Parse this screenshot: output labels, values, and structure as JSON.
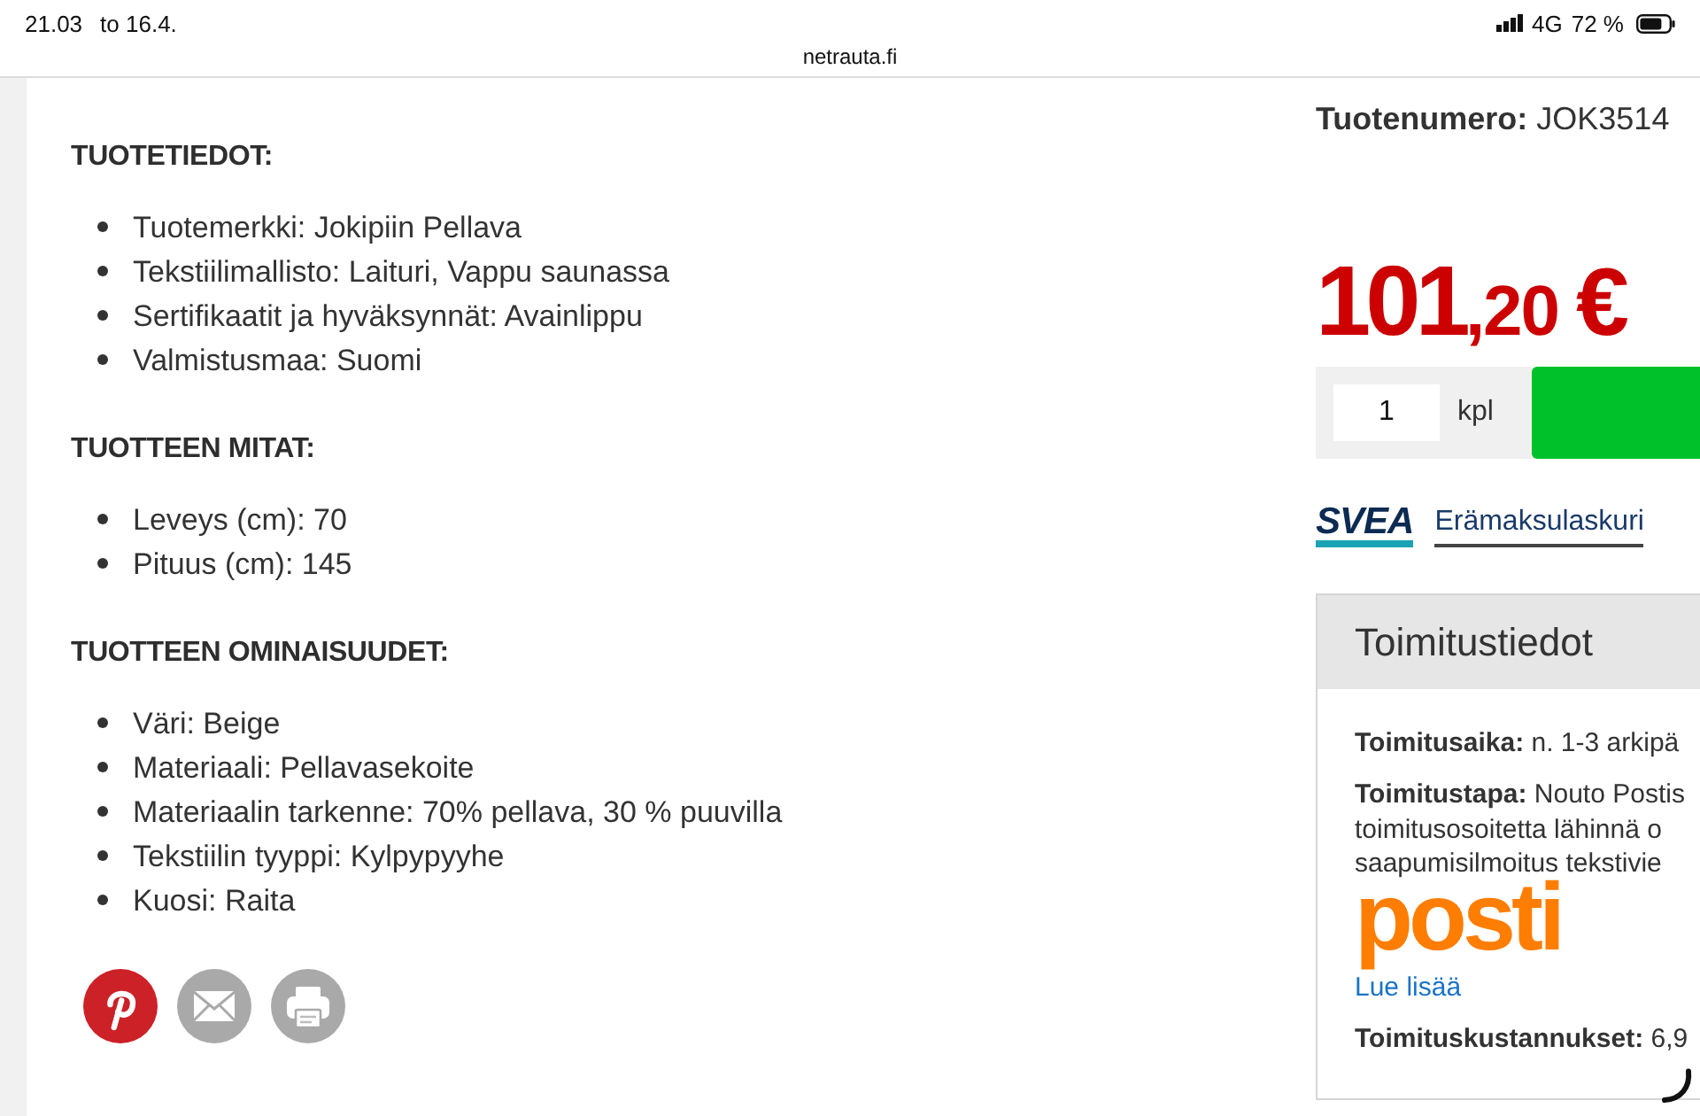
{
  "status_bar": {
    "time": "21.03",
    "date": "to 16.4.",
    "network": "4G",
    "battery": "72 %"
  },
  "address_bar": {
    "url": "netrauta.fi"
  },
  "sections": [
    {
      "heading": "TUOTETIEDOT:",
      "items": [
        "Tuotemerkki: Jokipiin Pellava",
        "Tekstiilimallisto: Laituri, Vappu saunassa",
        "Sertifikaatit ja hyväksynnät: Avainlippu",
        "Valmistusmaa: Suomi"
      ]
    },
    {
      "heading": "TUOTTEEN MITAT:",
      "items": [
        "Leveys (cm): 70",
        "Pituus (cm): 145"
      ]
    },
    {
      "heading": "TUOTTEEN OMINAISUUDET:",
      "items": [
        "Väri: Beige",
        "Materiaali: Pellavasekoite",
        "Materiaalin tarkenne: 70% pellava, 30 % puuvilla",
        "Tekstiilin tyyppi: Kylpypyyhe",
        "Kuosi: Raita"
      ]
    }
  ],
  "share_buttons": [
    {
      "kind": "pinterest"
    },
    {
      "kind": "email"
    },
    {
      "kind": "print"
    }
  ],
  "product": {
    "number": "**Tuotenumero:** JOK3514",
    "price": {
      "whole": "101",
      "fraction": ",20",
      "currency": "€"
    },
    "quantity": {
      "value": "1",
      "unit": "kpl"
    }
  },
  "financing": {
    "logo": "SVEA",
    "link": "Erämaksulaskuri"
  },
  "delivery": {
    "title": "Toimitustiedot",
    "time": "**Toimitusaika:** n. 1-3 arkipä",
    "method_lines": [
      "**Toimitustapa:** Nouto Postis",
      "toimitusosoitetta lähinnä o",
      "saapumisilmoitus tekstivie"
    ],
    "carrier_logo": "posti",
    "more_link": "Lue lisää",
    "cost": "**Toimituskustannukset:** 6,9"
  }
}
